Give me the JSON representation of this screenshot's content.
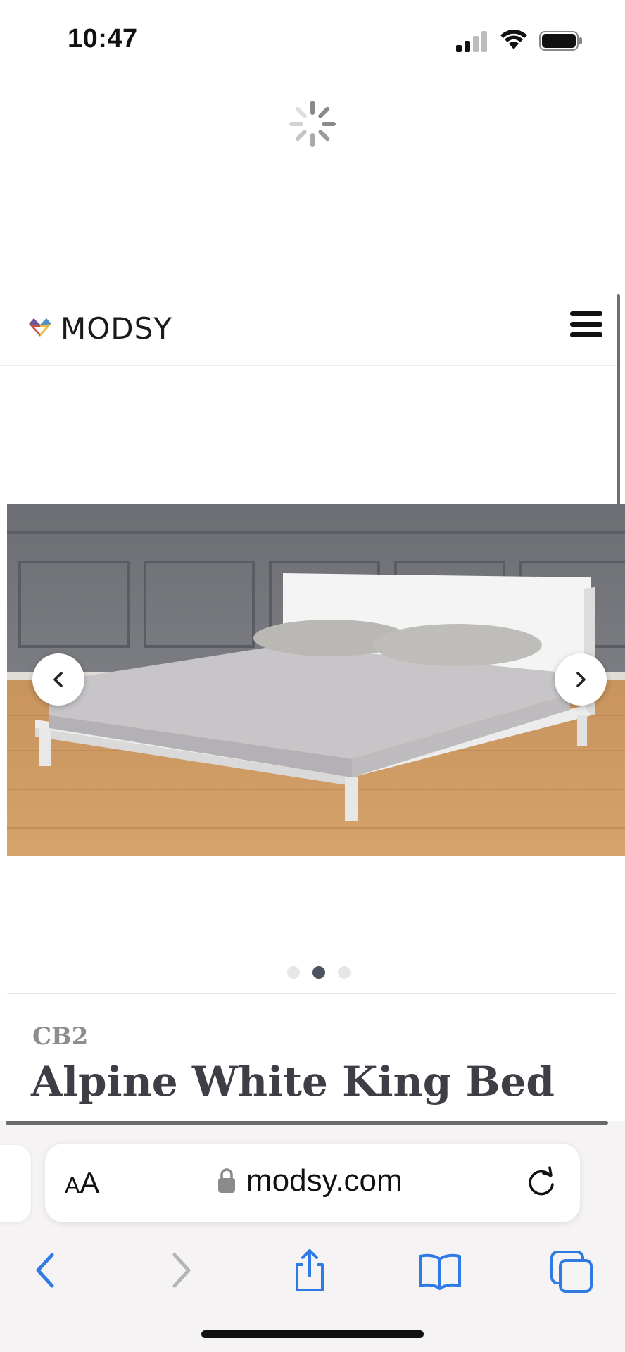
{
  "status_bar": {
    "time": "10:47",
    "signal_icon": "cellular-signal-icon",
    "wifi_icon": "wifi-icon",
    "battery_icon": "battery-icon"
  },
  "page": {
    "loading_icon": "spinner-icon",
    "header": {
      "logo_text": "MODSY",
      "logo_icon": "modsy-heart-icon",
      "menu_icon": "hamburger-menu-icon"
    },
    "carousel": {
      "prev_icon": "chevron-left-icon",
      "next_icon": "chevron-right-icon",
      "slide_count": 3,
      "active_slide": 2
    },
    "product": {
      "brand": "CB2",
      "title": "Alpine White King Bed"
    }
  },
  "browser": {
    "text_size_label_small": "A",
    "text_size_label_large": "A",
    "url": "modsy.com",
    "lock_icon": "lock-icon",
    "reload_icon": "reload-icon",
    "toolbar": {
      "back_icon": "chevron-left-icon",
      "forward_icon": "chevron-right-icon",
      "share_icon": "share-icon",
      "bookmarks_icon": "book-icon",
      "tabs_icon": "tabs-icon"
    }
  },
  "colors": {
    "safari_blue": "#2f7ae5",
    "title_text": "#3e3e46",
    "brand_text": "#8d8d8d",
    "active_dot": "#4a5560"
  }
}
